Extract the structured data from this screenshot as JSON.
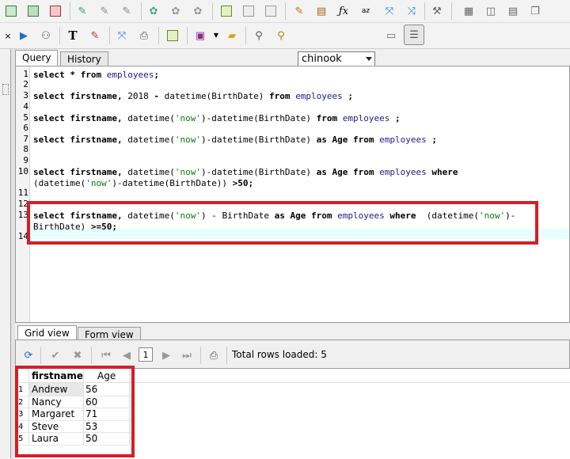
{
  "connection": {
    "database": "chinook"
  },
  "editor_tabs": [
    {
      "label": "Query"
    },
    {
      "label": "History"
    }
  ],
  "result_tabs": [
    {
      "label": "Grid view"
    },
    {
      "label": "Form view"
    }
  ],
  "pager": {
    "page": "1",
    "status": "Total rows loaded: 5"
  },
  "editor": {
    "line_numbers": [
      "1",
      "2",
      "3",
      "4",
      "5",
      "6",
      "7",
      "8",
      "9",
      "10",
      "11",
      "12",
      "13",
      "14"
    ]
  },
  "grid": {
    "columns": [
      "firstname",
      "Age"
    ],
    "row_numbers": [
      "1",
      "2",
      "3",
      "4",
      "5"
    ],
    "rows": [
      [
        "Andrew",
        "56"
      ],
      [
        "Nancy",
        "60"
      ],
      [
        "Margaret",
        "71"
      ],
      [
        "Steve",
        "53"
      ],
      [
        "Laura",
        "50"
      ]
    ]
  },
  "colors": {
    "highlight": "#d1202a",
    "table_name": "#1a1a8c",
    "string": "#0a7a0a"
  },
  "icons": {
    "toolbar1": [
      "new-query-icon",
      "add-icon",
      "delete-icon",
      "link-icon",
      "unlink-icon",
      "gear-icon",
      "gear-icon",
      "gear-icon",
      "table-icon",
      "table-icon",
      "table-icon",
      "edit-icon",
      "export-icon",
      "function-icon",
      "sort-icon",
      "expand-icon",
      "collapse-icon",
      "wrench-icon",
      "layout-icon",
      "layout-icon",
      "layout-icon",
      "layout-icon"
    ],
    "toolbar2": [
      "run-icon",
      "tree-icon",
      "text-icon",
      "edit-icon",
      "expand-icon",
      "print-icon",
      "table-icon",
      "save-icon",
      "open-folder-icon",
      "search-icon",
      "search-replace-icon",
      "layout-icon",
      "layout-icon"
    ]
  }
}
